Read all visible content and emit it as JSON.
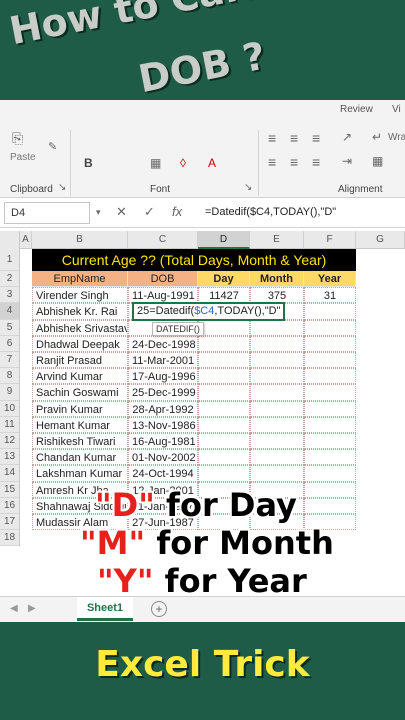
{
  "title": {
    "line1": "How to Calculate",
    "line2": "DOB ?"
  },
  "ribbon": {
    "tabs": [
      "Review",
      "Vi"
    ],
    "paste_label": "Paste",
    "groups": [
      "Clipboard",
      "Font",
      "Alignment"
    ],
    "wrap_label": "Wrap"
  },
  "formula_bar": {
    "name_box": "D4",
    "cancel": "✕",
    "enter": "✓",
    "fx": "fx",
    "formula": "=Datedif($C4,TODAY(),\"D\""
  },
  "grid": {
    "columns": [
      "A",
      "B",
      "C",
      "D",
      "E",
      "F",
      "G"
    ],
    "row_numbers": [
      "1",
      "2",
      "3",
      "4",
      "5",
      "6",
      "7",
      "8",
      "9",
      "10",
      "11",
      "12",
      "13",
      "14",
      "15",
      "16",
      "17",
      "18"
    ],
    "banner": "Current Age ?? (Total Days, Month & Year)",
    "headers": {
      "emp": "EmpName",
      "dob": "DOB",
      "day": "Day",
      "month": "Month",
      "year": "Year"
    },
    "rows": [
      {
        "name": "Virender Singh",
        "dob": "11-Aug-1991",
        "day": "11427",
        "month": "375",
        "year": "31"
      },
      {
        "name": "Abhishek Kr. Rai",
        "dob": "25",
        "day": "",
        "month": "",
        "year": ""
      },
      {
        "name": "Abhishek Srivastava",
        "dob": "11-",
        "day": "",
        "month": "",
        "year": ""
      },
      {
        "name": "Dhadwal Deepak",
        "dob": "24-Dec-1998",
        "day": "",
        "month": "",
        "year": ""
      },
      {
        "name": "Ranjit Prasad",
        "dob": "11-Mar-2001",
        "day": "",
        "month": "",
        "year": ""
      },
      {
        "name": "Arvind Kumar",
        "dob": "17-Aug-1996",
        "day": "",
        "month": "",
        "year": ""
      },
      {
        "name": "Sachin Goswami",
        "dob": "25-Dec-1999",
        "day": "",
        "month": "",
        "year": ""
      },
      {
        "name": "Pravin Kumar",
        "dob": "28-Apr-1992",
        "day": "",
        "month": "",
        "year": ""
      },
      {
        "name": "Hemant Kumar",
        "dob": "13-Nov-1986",
        "day": "",
        "month": "",
        "year": ""
      },
      {
        "name": "Rishikesh Tiwari",
        "dob": "16-Aug-1981",
        "day": "",
        "month": "",
        "year": ""
      },
      {
        "name": "Chandan Kumar",
        "dob": "01-Nov-2002",
        "day": "",
        "month": "",
        "year": ""
      },
      {
        "name": "Lakshman Kumar",
        "dob": "24-Oct-1994",
        "day": "",
        "month": "",
        "year": ""
      },
      {
        "name": "Amresh Kr Jha",
        "dob": "12-Jan-2001",
        "day": "",
        "month": "",
        "year": ""
      },
      {
        "name": "Shahnawaj Siddiqui",
        "dob": "11-Jan-1997",
        "day": "",
        "month": "",
        "year": ""
      },
      {
        "name": "Mudassir Alam",
        "dob": "27-Jun-1987",
        "day": "",
        "month": "",
        "year": ""
      }
    ],
    "editing_cell": {
      "prefix": "25=Datedif(",
      "ref": "$C4",
      "suffix": ",TODAY(),\"D\""
    },
    "tooltip": "DATEDIF()"
  },
  "overlay": {
    "line1": {
      "key": "\"D\"",
      "rest": " for Day"
    },
    "line2": {
      "key": "\"M\"",
      "rest": " for Month"
    },
    "line3": {
      "key": "\"Y\"",
      "rest": " for Year"
    }
  },
  "sheet_tabs": {
    "active": "Sheet1",
    "add": "+"
  },
  "footer": "Excel Trick",
  "colors": {
    "banner_green": "#1f5c48",
    "excel_green": "#217346",
    "header_peach": "#f4b183",
    "header_gold": "#ffd966",
    "title_yellow": "#ffe600"
  }
}
